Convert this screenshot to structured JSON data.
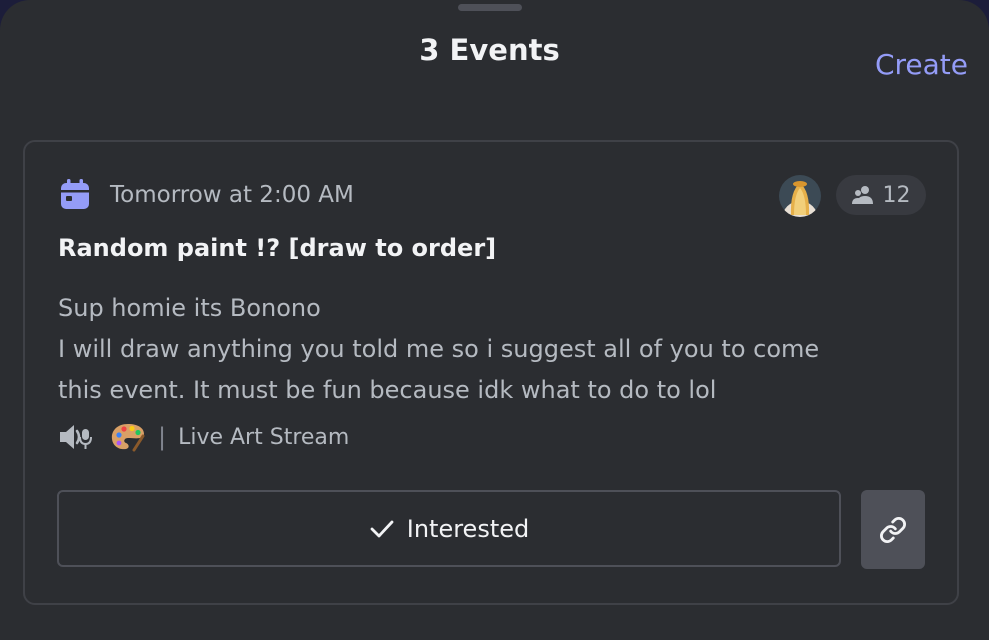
{
  "header": {
    "title": "3 Events",
    "create_label": "Create"
  },
  "event": {
    "date": "Tomorrow at 2:00 AM",
    "title": "Random paint !? [draw to order]",
    "description_lines": [
      "Sup homie its Bonono",
      "I will draw anything you told me so i suggest all of you to come",
      "this event. It must be fun because idk what to do to lol"
    ],
    "interested_count": "12",
    "location_separator": "|",
    "location": "Live Art Stream",
    "interested_label": "Interested",
    "icons": {
      "date": "calendar-icon",
      "attendees": "people-icon",
      "location": "stage-channel-icon",
      "emoji": "artist-palette-icon",
      "check": "check-icon",
      "link": "link-icon"
    }
  },
  "colors": {
    "accent": "#949cf7",
    "background": "#2b2d31",
    "outer_background": "#1c1d3a",
    "card_border": "#3f4147",
    "button_secondary": "#4e5058"
  }
}
